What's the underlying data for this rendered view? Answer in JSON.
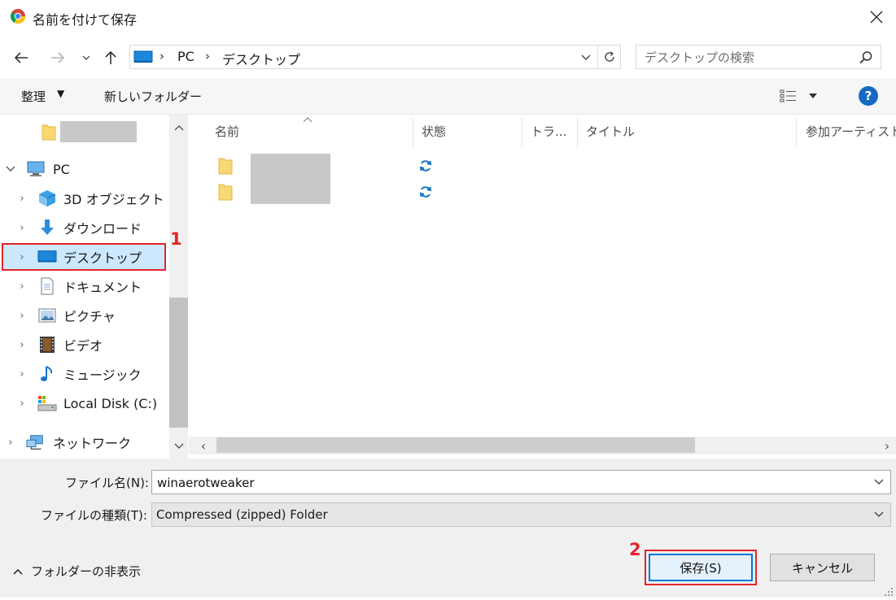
{
  "window": {
    "title": "名前を付けて保存",
    "close_icon": "close-icon"
  },
  "nav": {
    "back_icon": "arrow-left-icon",
    "forward_icon": "arrow-right-icon",
    "recent_icon": "chevron-down-icon",
    "up_icon": "arrow-up-icon",
    "breadcrumb": [
      "PC",
      "デスクトップ"
    ],
    "search_placeholder": "デスクトップの検索"
  },
  "toolbar": {
    "organize_label": "整理",
    "new_folder_label": "新しいフォルダー"
  },
  "tree": {
    "items": [
      {
        "label": "PC"
      },
      {
        "label": "3D オブジェクト"
      },
      {
        "label": "ダウンロード"
      },
      {
        "label": "デスクトップ",
        "selected": true
      },
      {
        "label": "ドキュメント"
      },
      {
        "label": "ピクチャ"
      },
      {
        "label": "ビデオ"
      },
      {
        "label": "ミュージック"
      },
      {
        "label": "Local Disk (C:)"
      },
      {
        "label": "ネットワーク"
      }
    ]
  },
  "columns": [
    "名前",
    "状態",
    "トラ...",
    "タイトル",
    "参加アーティスト"
  ],
  "bottom": {
    "filename_label": "ファイル名(N):",
    "filename_value": "winaerotweaker",
    "filetype_label": "ファイルの種類(T):",
    "filetype_value": "Compressed (zipped) Folder",
    "hide_folders_label": "フォルダーの非表示",
    "save_label": "保存(S)",
    "cancel_label": "キャンセル"
  },
  "annotations": {
    "callout_1": "1",
    "callout_2": "2"
  },
  "colors": {
    "accent": "#0078d7",
    "selection": "#cce8ff",
    "callout": "#e0252b",
    "folder": "#f8d775"
  }
}
